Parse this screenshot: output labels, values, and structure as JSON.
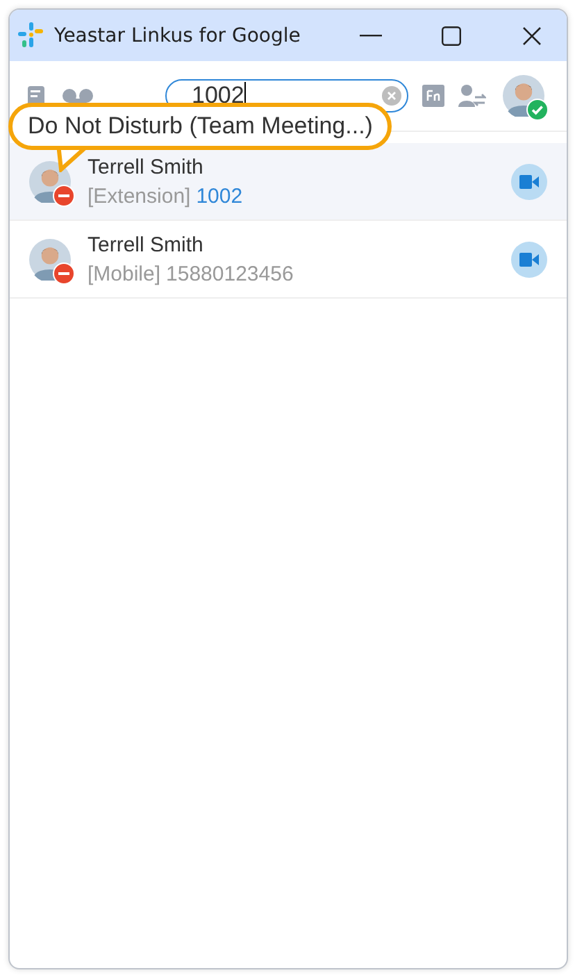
{
  "window": {
    "title": "Yeastar Linkus for Google"
  },
  "search": {
    "value": "1002"
  },
  "user": {
    "available": true
  },
  "tooltip": {
    "text": "Do Not Disturb (Team Meeting...)"
  },
  "contacts": [
    {
      "name": "Terrell Smith",
      "type": "[Extension]",
      "number": "1002",
      "matched": true,
      "dnd": true,
      "selected": true
    },
    {
      "name": "Terrell Smith",
      "type": "[Mobile]",
      "number": "15880123456",
      "matched": false,
      "dnd": true,
      "selected": false
    }
  ]
}
